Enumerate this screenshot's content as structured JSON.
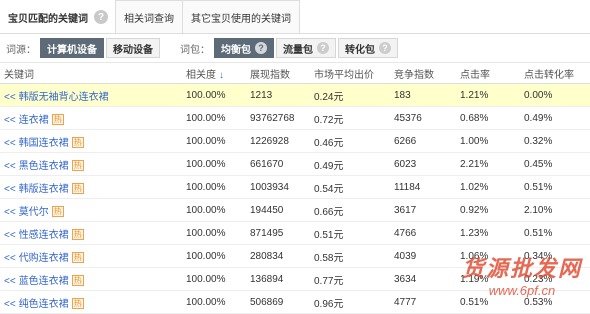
{
  "tabs": [
    {
      "label": "宝贝匹配的关键词",
      "active": true
    },
    {
      "label": "相关词查询",
      "active": false
    },
    {
      "label": "其它宝贝使用的关键词",
      "active": false
    }
  ],
  "filters": {
    "source_label": "词源：",
    "source_options": [
      "计算机设备",
      "移动设备"
    ],
    "package_label": "词包：",
    "package_options": [
      "均衡包",
      "流量包",
      "转化包"
    ]
  },
  "table": {
    "headers": [
      "关键词",
      "相关度",
      "展现指数",
      "市场平均出价",
      "竞争指数",
      "点击率",
      "点击转化率"
    ],
    "rows": [
      {
        "kw": "韩版无袖背心连衣裙",
        "hot": false,
        "rel": "100.00%",
        "show": "1213",
        "bid": "0.24元",
        "comp": "183",
        "ctr": "1.21%",
        "cvr": "0.00%",
        "highlight": true
      },
      {
        "kw": "连衣裙",
        "hot": true,
        "rel": "100.00%",
        "show": "93762768",
        "bid": "0.72元",
        "comp": "45376",
        "ctr": "0.68%",
        "cvr": "0.49%",
        "highlight": false
      },
      {
        "kw": "韩国连衣裙",
        "hot": true,
        "rel": "100.00%",
        "show": "1226928",
        "bid": "0.46元",
        "comp": "6266",
        "ctr": "1.00%",
        "cvr": "0.32%",
        "highlight": false
      },
      {
        "kw": "黑色连衣裙",
        "hot": true,
        "rel": "100.00%",
        "show": "661670",
        "bid": "0.49元",
        "comp": "6023",
        "ctr": "2.21%",
        "cvr": "0.45%",
        "highlight": false
      },
      {
        "kw": "韩版连衣裙",
        "hot": true,
        "rel": "100.00%",
        "show": "1003934",
        "bid": "0.54元",
        "comp": "11184",
        "ctr": "1.02%",
        "cvr": "0.51%",
        "highlight": false
      },
      {
        "kw": "莫代尔",
        "hot": true,
        "rel": "100.00%",
        "show": "194450",
        "bid": "0.66元",
        "comp": "3617",
        "ctr": "0.92%",
        "cvr": "2.10%",
        "highlight": false
      },
      {
        "kw": "性感连衣裙",
        "hot": true,
        "rel": "100.00%",
        "show": "871495",
        "bid": "0.51元",
        "comp": "4766",
        "ctr": "1.23%",
        "cvr": "0.51%",
        "highlight": false
      },
      {
        "kw": "代购连衣裙",
        "hot": true,
        "rel": "100.00%",
        "show": "280834",
        "bid": "0.58元",
        "comp": "4039",
        "ctr": "1.06%",
        "cvr": "0.34%",
        "highlight": false
      },
      {
        "kw": "蓝色连衣裙",
        "hot": true,
        "rel": "100.00%",
        "show": "136894",
        "bid": "0.77元",
        "comp": "3634",
        "ctr": "1.19%",
        "cvr": "0.23%",
        "highlight": false
      },
      {
        "kw": "纯色连衣裙",
        "hot": true,
        "rel": "100.00%",
        "show": "506869",
        "bid": "0.96元",
        "comp": "4777",
        "ctr": "0.51%",
        "cvr": "0.53%",
        "highlight": false
      }
    ],
    "row_prefix": "<<",
    "hot_label": "热"
  },
  "watermark": {
    "line1": "货源批发网",
    "line2": "www.6pf.cn"
  }
}
